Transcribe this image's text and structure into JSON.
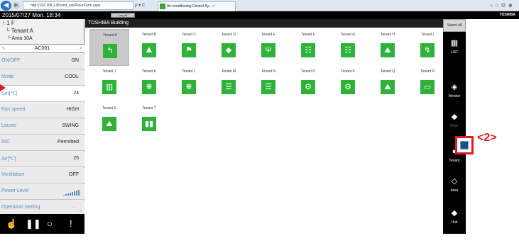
{
  "browser": {
    "address": "http://192.168.2.80/smt_usb/FloorForm.aspx",
    "address_ctrl": "ρ ▾ C",
    "tab_title": "Air-conditioning Control Sy... ×",
    "icons": "⌂☆⚙☻"
  },
  "titlebar": {
    "datetime": "2015/07/27 Mon. 18:34",
    "logoff": "Log off",
    "brand": "TOSHIBA"
  },
  "tree": {
    "floor": "1 F",
    "tenant": "Tenant A",
    "area": "Area 10A"
  },
  "unit_selector": {
    "value": "AC001",
    "prev": "<",
    "next": ">"
  },
  "params": [
    {
      "label": "ON/OFF",
      "value": "ON"
    },
    {
      "label": "Mode",
      "value": "COOL"
    },
    {
      "label": "Set[℃]",
      "value": "24"
    },
    {
      "label": "Fan speed",
      "value": "HIGH"
    },
    {
      "label": "Louver",
      "value": "SWING"
    },
    {
      "label": "R/C",
      "value": "Permitted"
    },
    {
      "label": "Air[℃]",
      "value": "25"
    },
    {
      "label": "Ventilation",
      "value": "OFF"
    },
    {
      "label": "Power Level",
      "value": ""
    },
    {
      "label": "Operation Setting",
      "value": "···"
    }
  ],
  "scroll_marker": "»",
  "bottom_controls": [
    "hand-icon",
    "pause-icon",
    "circle-icon",
    "exclamation-icon"
  ],
  "building_title": "TOSHIBA Building",
  "tenants": [
    {
      "name": "Tenant A",
      "glyph": "↰"
    },
    {
      "name": "Tenant B",
      "glyph": "⛰"
    },
    {
      "name": "Tenant C",
      "glyph": "⚑"
    },
    {
      "name": "Tenant D",
      "glyph": "◆"
    },
    {
      "name": "Tenant E",
      "glyph": "Ψ"
    },
    {
      "name": "Tenant F",
      "glyph": "☷"
    },
    {
      "name": "Tenant G",
      "glyph": "☷"
    },
    {
      "name": "Tenant H",
      "glyph": "⛰"
    },
    {
      "name": "Tenant I",
      "glyph": "↯"
    },
    {
      "name": "Tenant J",
      "glyph": "▥"
    },
    {
      "name": "Tenant K",
      "glyph": "❋"
    },
    {
      "name": "Tenant L",
      "glyph": "❋"
    },
    {
      "name": "Tenant M",
      "glyph": "☰"
    },
    {
      "name": "Tenant N",
      "glyph": "☰"
    },
    {
      "name": "Tenant O",
      "glyph": "⚙"
    },
    {
      "name": "Tenant P",
      "glyph": "⚙"
    },
    {
      "name": "Tenant Q",
      "glyph": "⛰"
    },
    {
      "name": "Tenant R",
      "glyph": "▭"
    },
    {
      "name": "Tenant S",
      "glyph": "⛰"
    },
    {
      "name": "Tenant T",
      "glyph": "▮▮"
    }
  ],
  "right_nav": {
    "select_all": "Select all",
    "items": [
      {
        "label": "LIST",
        "icon": "list-icon",
        "glyph": "▦"
      },
      {
        "label": "Monitor",
        "icon": "monitor-icon",
        "glyph": "◈"
      },
      {
        "label": "Floor",
        "icon": "floor-icon",
        "glyph": "◆"
      },
      {
        "label": "Tenant",
        "icon": "tenant-icon",
        "glyph": "●"
      },
      {
        "label": "Area",
        "icon": "area-icon",
        "glyph": "◇"
      },
      {
        "label": "Unit",
        "icon": "unit-icon",
        "glyph": "◆"
      }
    ]
  },
  "annotation": {
    "label": "<2>"
  },
  "colors": {
    "tenant_green": "#2fb23a",
    "accent_red": "#e01b24",
    "label_blue": "#5b8ec6"
  }
}
